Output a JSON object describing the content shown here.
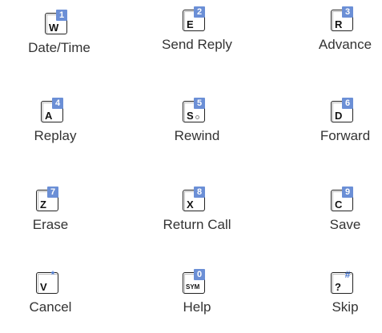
{
  "keys": [
    {
      "letter": "W",
      "badge": "1",
      "label": "Date/Time"
    },
    {
      "letter": "E",
      "badge": "2",
      "label": "Send Reply"
    },
    {
      "letter": "R",
      "badge": "3",
      "label": "Advance"
    },
    {
      "letter": "A",
      "badge": "4",
      "label": "Replay"
    },
    {
      "letter": "S",
      "badge": "5",
      "label": "Rewind"
    },
    {
      "letter": "D",
      "badge": "6",
      "label": "Forward"
    },
    {
      "letter": "Z",
      "badge": "7",
      "label": "Erase"
    },
    {
      "letter": "X",
      "badge": "8",
      "label": "Return Call"
    },
    {
      "letter": "C",
      "badge": "9",
      "label": "Save"
    },
    {
      "letter": "V",
      "badge": "*",
      "label": "Cancel"
    },
    {
      "letter": "SYM",
      "badge": "0",
      "label": "Help"
    },
    {
      "letter": "?",
      "badge": "#",
      "label": "Skip"
    }
  ],
  "colors": {
    "badge_blue": "#6b8fd6",
    "label_text": "#333333"
  }
}
